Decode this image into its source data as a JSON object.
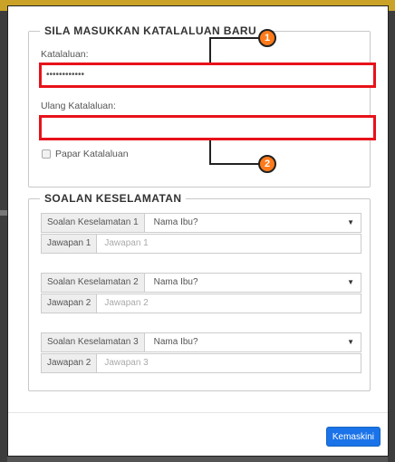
{
  "section_password": {
    "title": "SILA MASUKKAN KATALALUAN BARU",
    "password_label": "Katalaluan:",
    "password_value": "••••••••••••",
    "confirm_label": "Ulang Katalaluan:",
    "confirm_value": "",
    "show_password_label": "Papar Katalaluan",
    "show_password_checked": false
  },
  "section_security": {
    "title": "SOALAN KESELAMATAN",
    "questions": [
      {
        "question_label": "Soalan Keselamatan 1",
        "selected": "Nama Ibu?",
        "answer_label": "Jawapan 1",
        "answer_placeholder": "Jawapan 1"
      },
      {
        "question_label": "Soalan Keselamatan 2",
        "selected": "Nama Ibu?",
        "answer_label": "Jawapan 2",
        "answer_placeholder": "Jawapan 2"
      },
      {
        "question_label": "Soalan Keselamatan 3",
        "selected": "Nama Ibu?",
        "answer_label": "Jawapan 2",
        "answer_placeholder": "Jawapan 3"
      }
    ]
  },
  "footer": {
    "submit_label": "Kemaskini"
  },
  "callouts": {
    "one": "1",
    "two": "2",
    "color": "#ff7a1a"
  },
  "colors": {
    "highlight": "#e8121a",
    "button": "#1a73e8"
  },
  "icons": {
    "select_caret": "caret-down-icon"
  }
}
